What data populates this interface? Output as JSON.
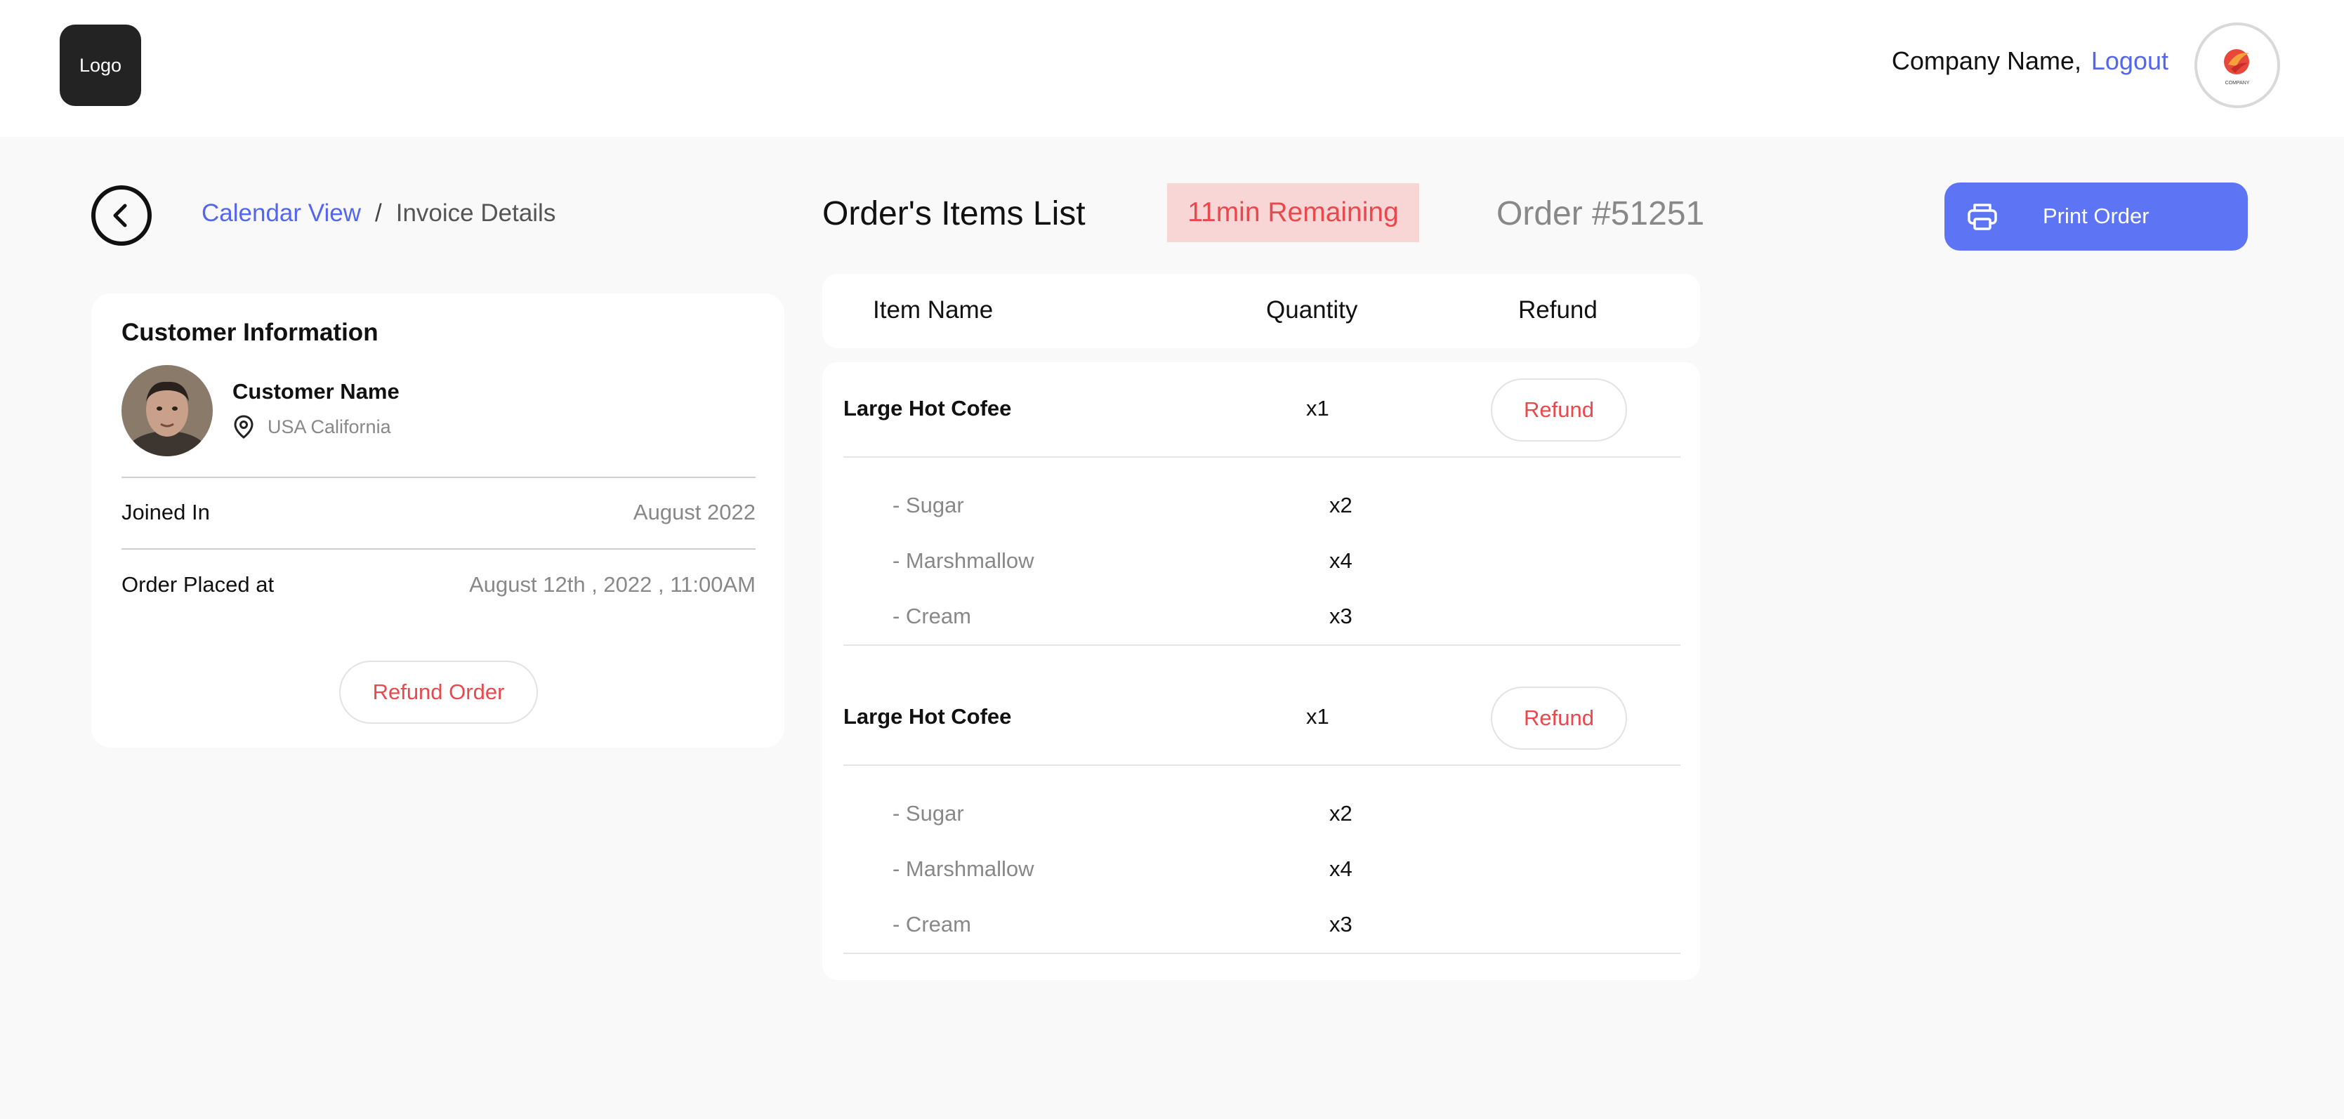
{
  "header": {
    "logo_text": "Logo",
    "company_name": "Company Name,",
    "logout_label": "Logout",
    "company_badge_text": "COMPANY"
  },
  "breadcrumb": {
    "parent": "Calendar View",
    "separator": "/",
    "current": "Invoice Details"
  },
  "customer": {
    "card_title": "Customer Information",
    "name": "Customer Name",
    "location": "USA California",
    "joined_label": "Joined In",
    "joined_value": "August 2022",
    "placed_label": "Order Placed at",
    "placed_value": "August 12th , 2022 , 11:00AM",
    "refund_order_label": "Refund Order"
  },
  "order": {
    "title": "Order's Items List",
    "remaining": "11min Remaining",
    "number": "Order #51251",
    "print_label": "Print Order",
    "columns": {
      "item": "Item Name",
      "quantity": "Quantity",
      "refund": "Refund"
    },
    "items": [
      {
        "name": "Large Hot Cofee",
        "qty": "x1",
        "refund_label": "Refund",
        "addons": [
          {
            "name": "- Sugar",
            "qty": "x2"
          },
          {
            "name": "- Marshmallow",
            "qty": "x4"
          },
          {
            "name": "- Cream",
            "qty": "x3"
          }
        ]
      },
      {
        "name": "Large Hot Cofee",
        "qty": "x1",
        "refund_label": "Refund",
        "addons": [
          {
            "name": "- Sugar",
            "qty": "x2"
          },
          {
            "name": "- Marshmallow",
            "qty": "x4"
          },
          {
            "name": "- Cream",
            "qty": "x3"
          }
        ]
      }
    ]
  },
  "colors": {
    "accent": "#5d74f4",
    "link": "#5566ee",
    "danger": "#e9484d",
    "badge_bg": "#f9d6d6",
    "page_bg": "#f9f9f9"
  },
  "icons": {
    "back": "chevron-left-icon",
    "location": "map-pin-icon",
    "print": "printer-icon"
  }
}
